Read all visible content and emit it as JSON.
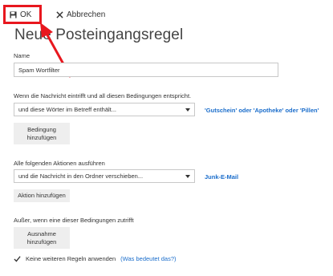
{
  "toolbar": {
    "ok_label": "OK",
    "cancel_label": "Abbrechen"
  },
  "page_title": "Neue Posteingangsregel",
  "name_section": {
    "label": "Name",
    "value": "Spam Wortfilter"
  },
  "condition_section": {
    "label": "Wenn die Nachricht eintrifft und all diesen Bedingungen entspricht.",
    "select_value": "und diese Wörter im Betreff enthält...",
    "condition_link": "'Gutschein' oder 'Apotheke' oder 'Pillen'",
    "add_button_line1": "Bedingung",
    "add_button_line2": "hinzufügen"
  },
  "action_section": {
    "label": "Alle folgenden Aktionen ausführen",
    "select_value": "und die Nachricht in den Ordner verschieben...",
    "action_link": "Junk-E-Mail",
    "add_button": "Aktion hinzufügen"
  },
  "exception_section": {
    "label": "Außer, wenn eine dieser Bedingungen zutrifft",
    "add_button_line1": "Ausnahme",
    "add_button_line2": "hinzufügen"
  },
  "stop_rules": {
    "checked": true,
    "label": "Keine weiteren Regeln anwenden",
    "help_link": "(Was bedeutet das?)"
  },
  "colors": {
    "highlight_red": "#e8171e",
    "link_blue": "#1a6dcb"
  }
}
